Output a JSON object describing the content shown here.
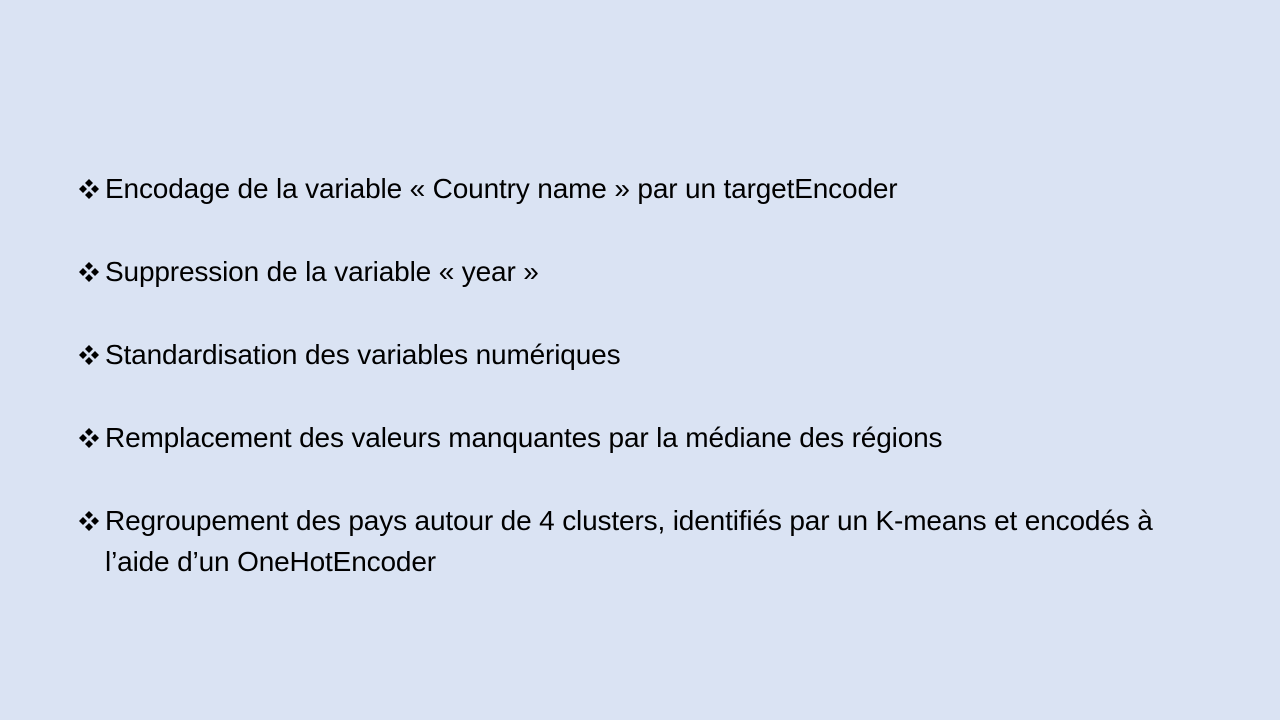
{
  "slide": {
    "bullets": [
      {
        "icon": "diamond-bullet-icon",
        "text": "Encodage de la variable « Country name » par un targetEncoder"
      },
      {
        "icon": "diamond-bullet-icon",
        "text": "Suppression de la variable « year »"
      },
      {
        "icon": "diamond-bullet-icon",
        "text": "Standardisation des variables numériques"
      },
      {
        "icon": "diamond-bullet-icon",
        "text": "Remplacement des valeurs manquantes par la médiane des régions"
      },
      {
        "icon": "diamond-bullet-icon",
        "text": "Regroupement des pays autour de 4 clusters, identifiés par un K-means et encodés à l’aide d’un OneHotEncoder"
      }
    ],
    "background_color": "#dae3f3",
    "text_color": "#000000"
  }
}
